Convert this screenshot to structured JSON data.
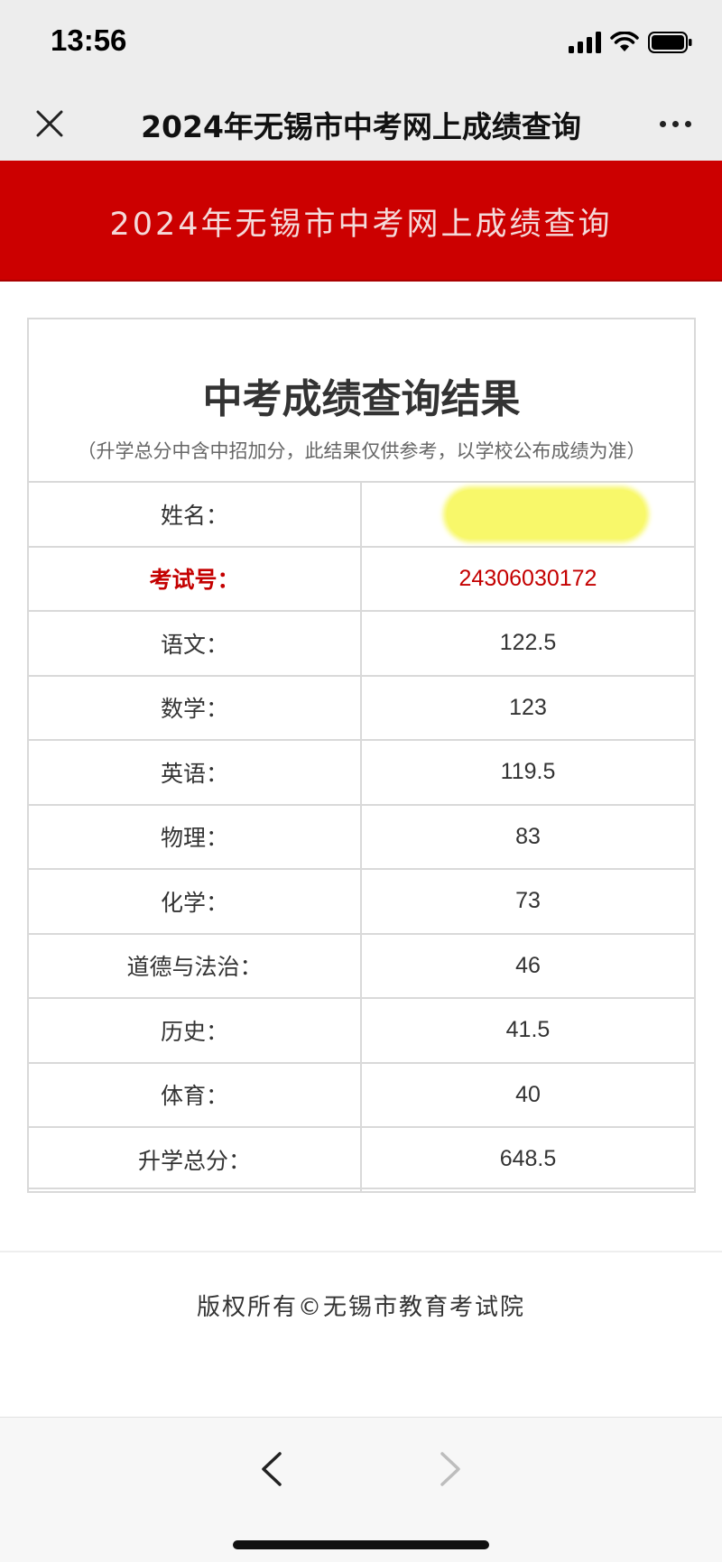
{
  "status_bar": {
    "time": "13:56"
  },
  "nav": {
    "title": "2024年无锡市中考网上成绩查询"
  },
  "banner": {
    "title": "2024年无锡市中考网上成绩查询"
  },
  "result": {
    "title": "中考成绩查询结果",
    "note": "（升学总分中含中招加分，此结果仅供参考，以学校公布成绩为准）",
    "name_label": "姓名：",
    "exam_id_label": "考试号：",
    "exam_id": "24306030172",
    "scores": [
      {
        "label": "语文：",
        "value": "122.5"
      },
      {
        "label": "数学：",
        "value": "123"
      },
      {
        "label": "英语：",
        "value": "119.5"
      },
      {
        "label": "物理：",
        "value": "83"
      },
      {
        "label": "化学：",
        "value": "73"
      },
      {
        "label": "道德与法治：",
        "value": "46"
      },
      {
        "label": "历史：",
        "value": "41.5"
      },
      {
        "label": "体育：",
        "value": "40"
      },
      {
        "label": "升学总分：",
        "value": "648.5"
      }
    ]
  },
  "footer": {
    "copyright": "版权所有©无锡市教育考试院"
  },
  "colors": {
    "banner_red": "#cc0000",
    "highlight_red": "#c40000"
  }
}
